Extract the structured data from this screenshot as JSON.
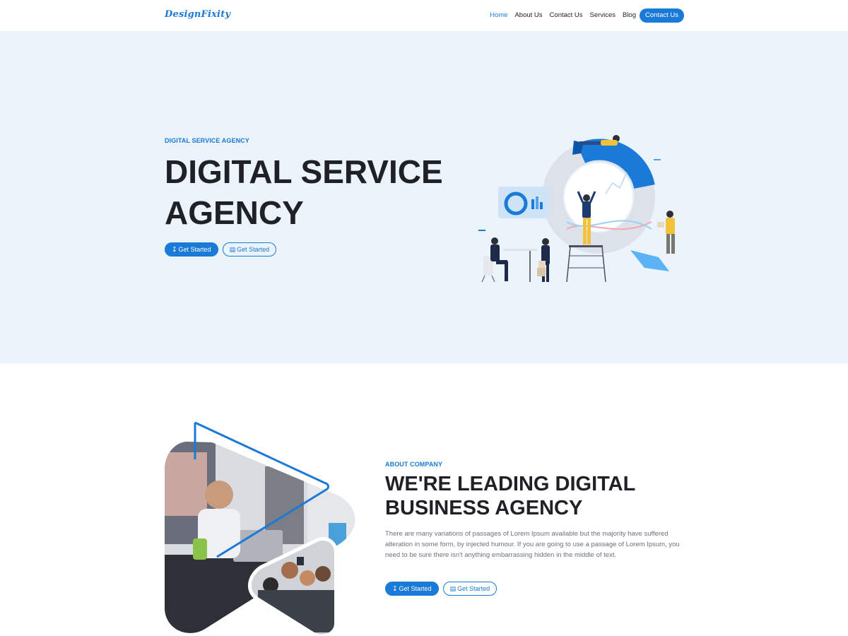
{
  "brand": {
    "logo_text": "DesignFixity",
    "accent": "#1a7ad8"
  },
  "nav": {
    "links": [
      {
        "label": "Home",
        "active": true
      },
      {
        "label": "About Us",
        "active": false
      },
      {
        "label": "Contact Us",
        "active": false
      },
      {
        "label": "Services",
        "active": false
      },
      {
        "label": "Blog",
        "active": false
      }
    ],
    "cta_label": "Contact Us"
  },
  "hero": {
    "eyebrow": "DIGITAL SERVICE AGENCY",
    "title": "DIGITAL SERVICE AGENCY",
    "primary_button": {
      "label": "Get Started",
      "icon": "download-arrow-icon"
    },
    "secondary_button": {
      "label": "Get Started",
      "icon": "inbox-icon"
    },
    "background": "#ebf3fb"
  },
  "about": {
    "eyebrow": "ABOUT COMPANY",
    "title": "WE'RE LEADING DIGITAL BUSINESS AGENCY",
    "body": "There are many variations of passages of Lorem Ipsum available but the majority have suffered alteration in some form, by injected humour. If you are going to use a passage of Lorem Ipsum, you need to be sure there isn't anything embarrassing hidden in the middle of text.",
    "primary_button": {
      "label": "Get Started",
      "icon": "download-arrow-icon"
    },
    "secondary_button": {
      "label": "Get Started",
      "icon": "inbox-icon"
    }
  }
}
